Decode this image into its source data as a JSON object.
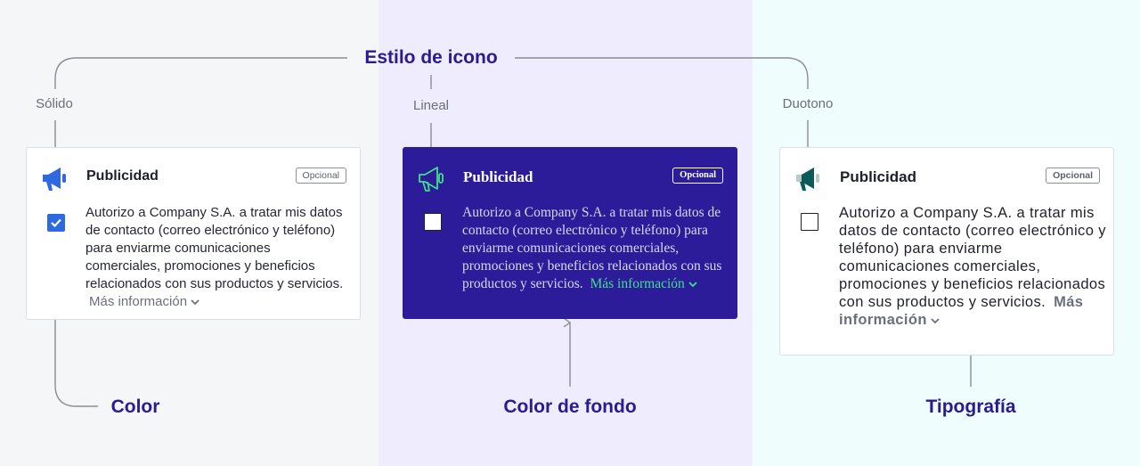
{
  "headings": {
    "icon_style": "Estilo de icono",
    "color": "Color",
    "background": "Color de fondo",
    "typography": "Tipografía"
  },
  "sublabels": {
    "solid": "Sólido",
    "linear": "Lineal",
    "duotone": "Duotono"
  },
  "cards": [
    {
      "title": "Publicidad",
      "badge": "Opcional",
      "checked": true,
      "body": "Autorizo a Company S.A. a tratar mis datos de contacto (correo electrónico y teléfono) para enviarme comunicaciones comerciales, promociones y beneficios relacionados con sus productos y servicios.",
      "more": "Más información",
      "icon": "megaphone-solid-icon"
    },
    {
      "title": "Publicidad",
      "badge": "Opcional",
      "checked": false,
      "body": "Autorizo a Company S.A. a tratar mis datos de contacto (correo electrónico y teléfono) para enviarme comunicaciones comerciales, promociones y beneficios relacionados con sus productos y servicios.",
      "more": "Más información",
      "icon": "megaphone-outline-icon"
    },
    {
      "title": "Publicidad",
      "badge": "Opcional",
      "checked": false,
      "body": "Autorizo a Company S.A. a tratar mis datos de contacto (correo electrónico y teléfono) para enviarme comunicaciones comerciales, promociones y beneficios relacionados con sus productos y servicios.",
      "more": "Más información",
      "icon": "megaphone-duotone-icon"
    }
  ],
  "colors": {
    "heading": "#2b1b8f",
    "accent_blue": "#2d6ae0",
    "card_dark": "#2c1c9a",
    "link_green": "#3ee08a",
    "duotone_teal": "#0d5a5a"
  }
}
